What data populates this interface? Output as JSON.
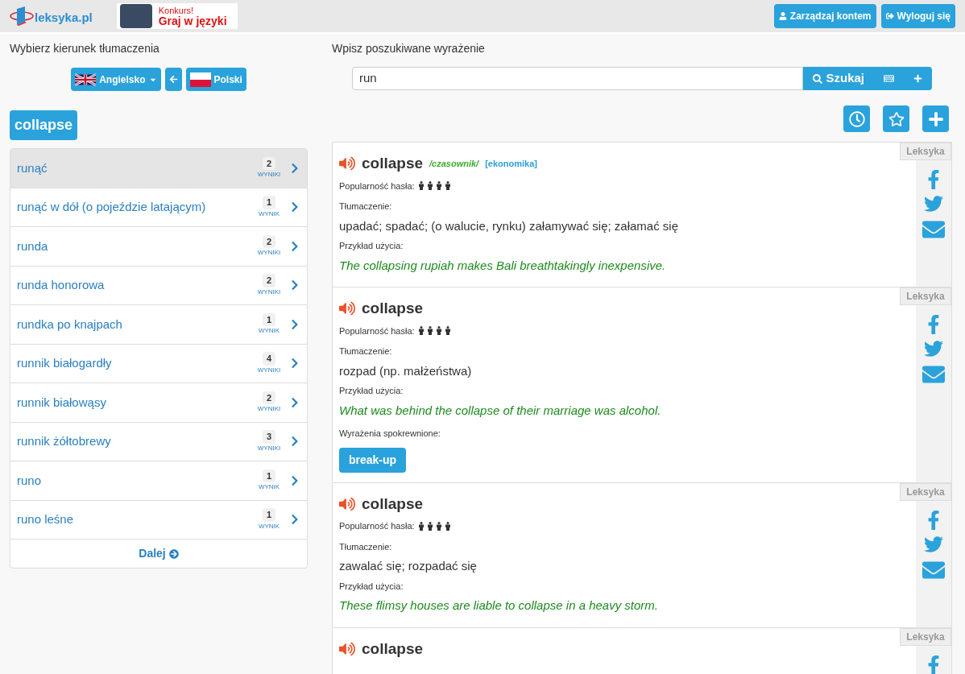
{
  "header": {
    "logo": "leksyka.pl",
    "banner": {
      "line1": "Konkurs!",
      "line2": "Graj w języki"
    },
    "buttons": [
      {
        "kind": "user",
        "label": "Zarządzaj kontem"
      },
      {
        "kind": "logout",
        "label": "Wyloguj się"
      }
    ]
  },
  "direction": {
    "title": "Wybierz kierunek tłumaczenia",
    "source": "Angielsko",
    "target": "Polski"
  },
  "search": {
    "title": "Wpisz poszukiwane wyrażenie",
    "value": "run",
    "button": "Szukaj"
  },
  "current_word": "collapse",
  "results": [
    {
      "label": "runąć",
      "count": "2",
      "count_label": "WYNIKI",
      "selected": true
    },
    {
      "label": "runąć w dół (o pojeździe latającym)",
      "count": "1",
      "count_label": "WYNIK",
      "selected": false
    },
    {
      "label": "runda",
      "count": "2",
      "count_label": "WYNIKI",
      "selected": false
    },
    {
      "label": "runda honorowa",
      "count": "2",
      "count_label": "WYNIKI",
      "selected": false
    },
    {
      "label": "rundka po knajpach",
      "count": "1",
      "count_label": "WYNIK",
      "selected": false
    },
    {
      "label": "runnik białogardły",
      "count": "4",
      "count_label": "WYNIKI",
      "selected": false
    },
    {
      "label": "runnik białowąsy",
      "count": "2",
      "count_label": "WYNIKI",
      "selected": false
    },
    {
      "label": "runnik żółtobrewy",
      "count": "3",
      "count_label": "WYNIKI",
      "selected": false
    },
    {
      "label": "runo",
      "count": "1",
      "count_label": "WYNIK",
      "selected": false
    },
    {
      "label": "runo leśne",
      "count": "1",
      "count_label": "WYNIK",
      "selected": false
    }
  ],
  "next": "Dalej",
  "entries": [
    {
      "source": "Leksyka",
      "word": "collapse",
      "pos": "/czasownik/",
      "domain": "[ekonomika]",
      "popularity_label": "Popularność hasła:",
      "stars": 4,
      "translation_label": "Tłumaczenie:",
      "translation": "upadać; spadać; (o walucie, rynku) załamywać się; załamać się",
      "example_label": "Przykład użycia:",
      "example": "The collapsing rupiah makes Bali breathtakingly inexpensive."
    },
    {
      "source": "Leksyka",
      "word": "collapse",
      "popularity_label": "Popularność hasła:",
      "stars": 4,
      "translation_label": "Tłumaczenie:",
      "translation": "rozpad (np. małżeństwa)",
      "example_label": "Przykład użycia:",
      "example": "What was behind the collapse of their marriage was alcohol.",
      "related_label": "Wyrażenia spokrewnione:",
      "related": [
        "break-up"
      ]
    },
    {
      "source": "Leksyka",
      "word": "collapse",
      "popularity_label": "Popularność hasła:",
      "stars": 4,
      "translation_label": "Tłumaczenie:",
      "translation": "zawalać się; rozpadać się",
      "example_label": "Przykład użycia:",
      "example": "These flimsy houses are liable to collapse in a heavy storm."
    },
    {
      "source": "Leksyka",
      "word": "collapse"
    }
  ]
}
